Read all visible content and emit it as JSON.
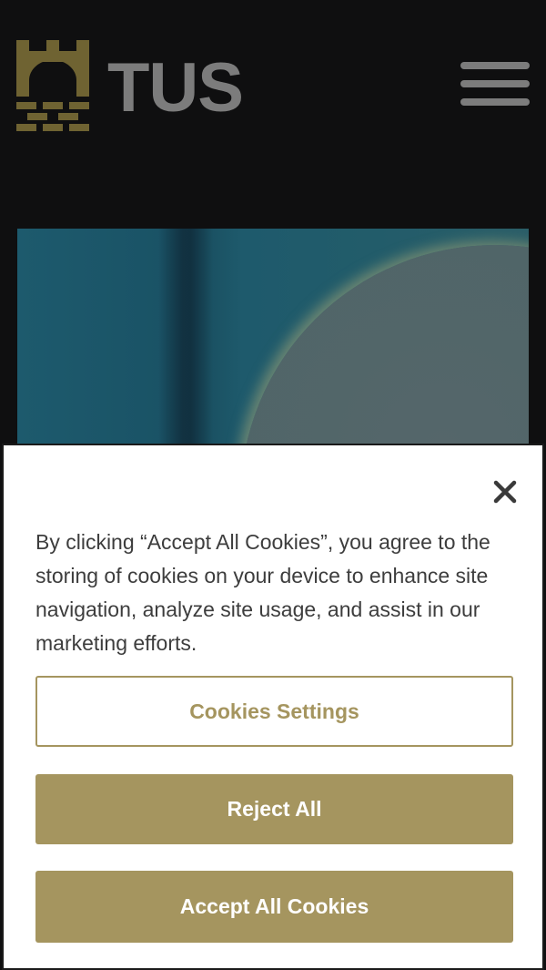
{
  "header": {
    "logo_text": "TUS",
    "logo_mark_icon": "castle-tower-icon",
    "menu_icon": "hamburger-menu-icon"
  },
  "hero": {
    "image": "blurred-teal-photo"
  },
  "cookie_banner": {
    "close_icon": "close-icon",
    "message": "By clicking “Accept All Cookies”, you agree to the storing of cookies on your device to enhance site navigation, analyze site usage, and assist in our marketing efforts.",
    "settings_label": "Cookies Settings",
    "reject_label": "Reject All",
    "accept_label": "Accept All Cookies"
  },
  "colors": {
    "page_background": "#0f0f10",
    "brand_gold": "#a5955f",
    "logo_grey": "#7c7c7c",
    "text": "#3d3d3d"
  }
}
